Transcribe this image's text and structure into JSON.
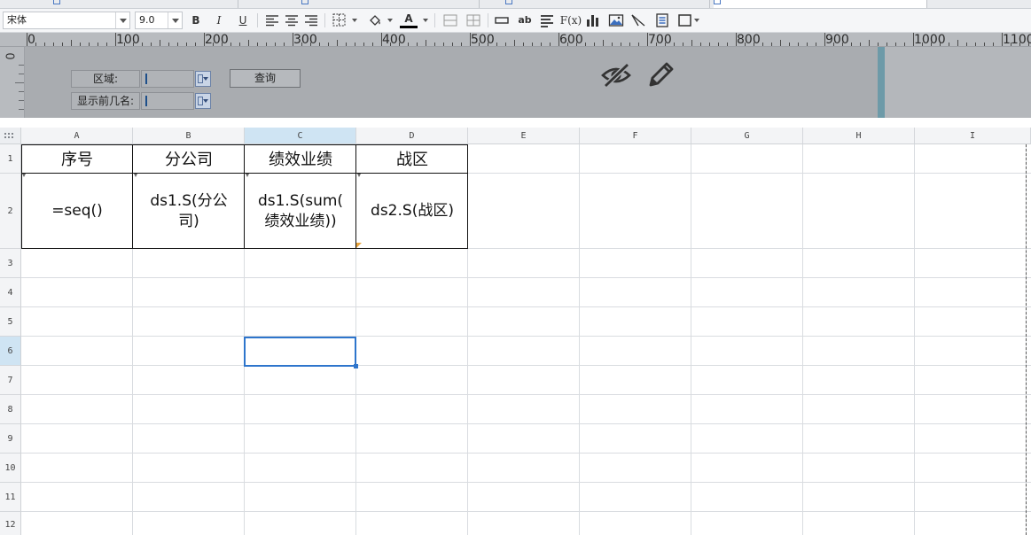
{
  "toolbar": {
    "font_family": "宋体",
    "font_size": "9.0",
    "bold_label": "B",
    "italic_label": "I",
    "underline_label": "U",
    "formula_label": "F(x)",
    "ab_label": "ab",
    "font_color_label": "A",
    "font_color": "#000000"
  },
  "ruler": {
    "labels": [
      "0",
      "100",
      "200",
      "300",
      "400",
      "500",
      "600",
      "700",
      "800",
      "900",
      "1000",
      "1100"
    ],
    "vertical_label": "0"
  },
  "parameter_panel": {
    "region_label": "区域:",
    "top_n_label": "显示前几名:",
    "query_button": "查询"
  },
  "grid": {
    "columns": [
      "A",
      "B",
      "C",
      "D",
      "E",
      "F",
      "G",
      "H",
      "I"
    ],
    "selected_column": "C",
    "rows": [
      "1",
      "2",
      "3",
      "4",
      "5",
      "6",
      "7",
      "8",
      "9",
      "10",
      "11",
      "12"
    ],
    "selected_row": "6",
    "header_cells": [
      "序号",
      "分公司",
      "绩效业绩",
      "战区"
    ],
    "formula_cells": [
      {
        "line1": "=seq()",
        "line2": ""
      },
      {
        "line1": "ds1.S(分公",
        "line2": "司)"
      },
      {
        "line1": "ds1.S(sum(",
        "line2": "绩效业绩))"
      },
      {
        "line1": "ds2.S(战区)",
        "line2": ""
      }
    ],
    "selection_color": "#2e75cc"
  }
}
